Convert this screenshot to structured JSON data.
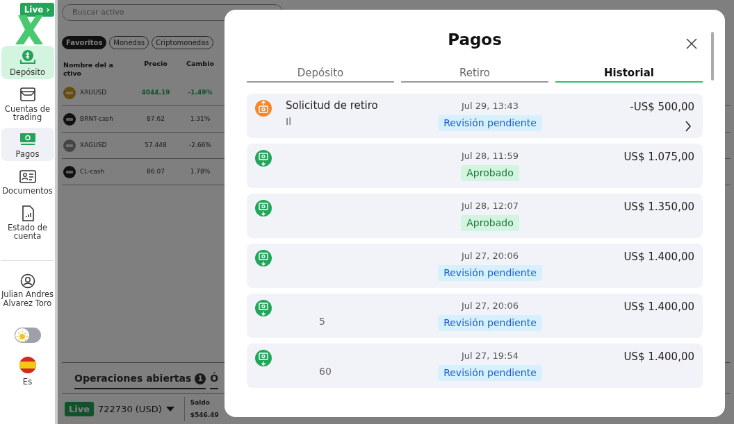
{
  "brand": {
    "badge": "Live ›"
  },
  "sidebar": {
    "items": [
      {
        "label": "Depósito",
        "selected": true,
        "hovered": false
      },
      {
        "label": "Cuentas de trading",
        "selected": false,
        "hovered": false
      },
      {
        "label": "Pagos",
        "selected": false,
        "hovered": true
      },
      {
        "label": "Documentos",
        "selected": false,
        "hovered": false
      },
      {
        "label": "Estado de cuenta",
        "selected": false,
        "hovered": false
      }
    ],
    "user": {
      "name": "Julian Andres Alvarez Toro"
    },
    "theme_toggle": {
      "dark": false
    },
    "language": {
      "label": "Es"
    }
  },
  "market": {
    "search": {
      "placeholder": "Buscar activo"
    },
    "filters": [
      {
        "label": "Favoritos",
        "selected": true
      },
      {
        "label": "Monedas",
        "selected": false
      },
      {
        "label": "Criptomonedas",
        "selected": false
      }
    ],
    "columns": [
      "Nombre del activo",
      "Precio",
      "Cambio"
    ],
    "rows": [
      {
        "symbol": "XAUUSD",
        "price": "4044.19",
        "change": "-1.49%",
        "highlight": true
      },
      {
        "symbol": "BRNT-cash",
        "price": "87.62",
        "change": "1.31%",
        "highlight": false
      },
      {
        "symbol": "XAGUSD",
        "price": "57.448",
        "change": "-2.66%",
        "highlight": false
      },
      {
        "symbol": "CL-cash",
        "price": "86.07",
        "change": "1.78%",
        "highlight": false
      }
    ]
  },
  "positions": {
    "tabs": [
      {
        "label": "Operaciones abiertas",
        "count": "1"
      },
      {
        "label": "Ó"
      }
    ]
  },
  "account_bar": {
    "badge": "Live",
    "account": "722730 (USD)",
    "balance_label": "Saldo",
    "balance": "$546.49"
  },
  "modal": {
    "title": "Pagos",
    "tabs": [
      {
        "label": "Depósito",
        "selected": false
      },
      {
        "label": "Retiro",
        "selected": false
      },
      {
        "label": "Historial",
        "selected": true
      }
    ],
    "transactions": [
      {
        "kind": "withdrawal",
        "title": "Solicitud de retiro",
        "subtitle": "Il",
        "date": "Jul 29, 13:43",
        "status": {
          "label": "Revisión pendiente",
          "kind": "pending"
        },
        "amount": "-US$ 500,00",
        "has_details": true
      },
      {
        "kind": "deposit",
        "date": "Jul 28, 11:59",
        "status": {
          "label": "Aprobado",
          "kind": "approved"
        },
        "amount": "US$ 1.075,00",
        "has_details": false
      },
      {
        "kind": "deposit",
        "date": "Jul 28, 12:07",
        "status": {
          "label": "Aprobado",
          "kind": "approved"
        },
        "amount": "US$ 1.350,00",
        "has_details": false
      },
      {
        "kind": "deposit",
        "date": "Jul 27, 20:06",
        "status": {
          "label": "Revisión pendiente",
          "kind": "pending"
        },
        "amount": "US$ 1.400,00",
        "has_details": false
      },
      {
        "kind": "deposit",
        "subtitle": "5",
        "date": "Jul 27, 20:06",
        "status": {
          "label": "Revisión pendiente",
          "kind": "pending"
        },
        "amount": "US$ 1.400,00",
        "has_details": false
      },
      {
        "kind": "deposit",
        "subtitle": "60",
        "date": "Jul 27, 19:54",
        "status": {
          "label": "Revisión pendiente",
          "kind": "pending"
        },
        "amount": "US$ 1.400,00",
        "has_details": false
      }
    ]
  }
}
